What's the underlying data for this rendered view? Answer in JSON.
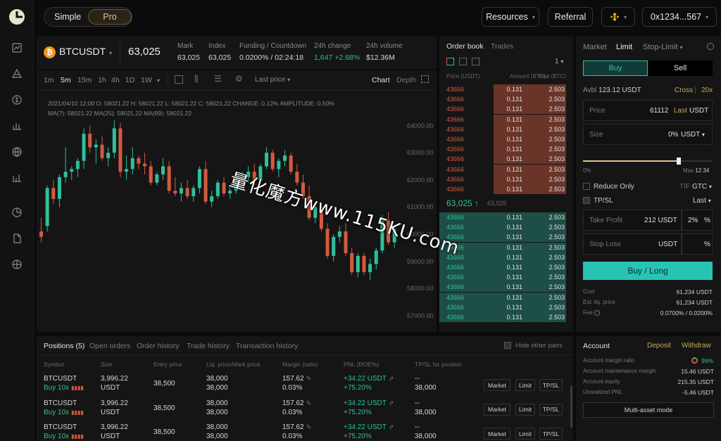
{
  "header": {
    "mode_simple": "Simple",
    "mode_pro": "Pro",
    "resources": "Resources",
    "referral": "Referral",
    "wallet": "0x1234...567"
  },
  "ticker": {
    "symbol": "BTCUSDT",
    "price": "63,025",
    "mark_label": "Mark",
    "mark_value": "63,025",
    "index_label": "Index",
    "index_value": "63,025",
    "funding_label": "Funding / Countdown",
    "funding_value": "0.0200% / 02:24:18",
    "change_label": "24h change",
    "change_value": "1,647 +2.68%",
    "volume_label": "24h volume",
    "volume_value": "$12.36M"
  },
  "chart": {
    "timeframes": [
      "1m",
      "5m",
      "15m",
      "1h",
      "4h",
      "1D",
      "1W"
    ],
    "active_timeframe": "5m",
    "price_type": "Last price",
    "view_chart": "Chart",
    "view_depth": "Depth",
    "ohlc_line": "2021/04/10 12:00  O: 58021.22  H: 58021.22  L: 58021.22  C: 58021.22  CHANGE: 0.12%  AMPLITUDE: 0.50%",
    "ma_line": "MA(7): 58021.22  MA(25): 58021.22  MA(99): 58021.22",
    "y_axis": [
      "64000.00",
      "63000.00",
      "62000.00",
      "61000.00",
      "60000.00",
      "59000.00",
      "58000.00",
      "57000.00"
    ],
    "colors": {
      "up": "#2fbf9b",
      "down": "#d25a3f"
    }
  },
  "chart_data": {
    "type": "candlestick",
    "ylim": [
      56500,
      65000
    ],
    "candles": [
      [
        60100,
        60600,
        59700,
        59900
      ],
      [
        60300,
        61800,
        60100,
        61700
      ],
      [
        61700,
        62000,
        61100,
        61300
      ],
      [
        61300,
        62200,
        61000,
        62100
      ],
      [
        62100,
        63200,
        61900,
        62300
      ],
      [
        62300,
        62500,
        62000,
        62400
      ],
      [
        62400,
        62800,
        62100,
        62700
      ],
      [
        62700,
        63900,
        62400,
        63700
      ],
      [
        63700,
        64000,
        63000,
        63200
      ],
      [
        63200,
        63500,
        62600,
        63300
      ],
      [
        63300,
        63600,
        62700,
        62800
      ],
      [
        62800,
        63200,
        62500,
        63000
      ],
      [
        63000,
        64200,
        62800,
        63900
      ],
      [
        63900,
        64100,
        62100,
        62300
      ],
      [
        62300,
        62900,
        62000,
        62400
      ],
      [
        62400,
        63200,
        62200,
        62800
      ],
      [
        62800,
        62900,
        62400,
        62600
      ],
      [
        62600,
        63000,
        62200,
        62500
      ],
      [
        62500,
        62700,
        61800,
        61900
      ],
      [
        61900,
        62300,
        61800,
        62200
      ],
      [
        62200,
        62800,
        62000,
        62500
      ],
      [
        62500,
        62700,
        61500,
        61600
      ],
      [
        61600,
        62100,
        61400,
        61500
      ],
      [
        61500,
        61900,
        61200,
        61700
      ],
      [
        61700,
        62000,
        61300,
        61400
      ],
      [
        61400,
        61800,
        61200,
        61700
      ],
      [
        61700,
        62500,
        61500,
        62400
      ],
      [
        62400,
        62700,
        61100,
        61200
      ],
      [
        61200,
        61600,
        61000,
        61400
      ],
      [
        61400,
        62000,
        61300,
        61900
      ],
      [
        61900,
        62100,
        61400,
        61500
      ],
      [
        61500,
        61800,
        61300,
        61600
      ],
      [
        61600,
        62100,
        61500,
        62000
      ],
      [
        62000,
        62300,
        61900,
        62100
      ],
      [
        62100,
        62500,
        61900,
        62300
      ],
      [
        62300,
        62600,
        61800,
        62000
      ],
      [
        62000,
        62600,
        61900,
        62500
      ],
      [
        62500,
        63200,
        62400,
        63000
      ],
      [
        63000,
        63100,
        62300,
        62400
      ],
      [
        62400,
        62800,
        62100,
        62700
      ],
      [
        62700,
        63100,
        62500,
        62900
      ],
      [
        62900,
        63000,
        62200,
        62300
      ],
      [
        62300,
        62600,
        61800,
        61900
      ],
      [
        61900,
        62200,
        61300,
        61400
      ],
      [
        61400,
        61800,
        60500,
        60600
      ],
      [
        60600,
        61100,
        60400,
        61000
      ],
      [
        61000,
        61100,
        60100,
        60200
      ],
      [
        60200,
        60400,
        59100,
        59200
      ],
      [
        59200,
        60000,
        59000,
        59900
      ],
      [
        59900,
        60300,
        59700,
        60100
      ],
      [
        60100,
        60400,
        59200,
        59300
      ],
      [
        59300,
        59500,
        58500,
        58600
      ],
      [
        58600,
        59300,
        58400,
        59200
      ],
      [
        59200,
        59300,
        58500,
        58600
      ],
      [
        58600,
        59100,
        58300,
        58900
      ],
      [
        58900,
        59500,
        58700,
        59400
      ],
      [
        59400,
        60700,
        59300,
        60500
      ],
      [
        60500,
        60800,
        59600,
        59700
      ],
      [
        59700,
        60300,
        59500,
        60200
      ]
    ]
  },
  "orderbook": {
    "tab_book": "Order book",
    "tab_trades": "Trades",
    "depth_select": "1",
    "col_price": "Price (USDT)",
    "col_amount": "Amount (BTC)",
    "col_total": "Total (BTC)",
    "asks": [
      [
        "43666",
        "0.131",
        "2.503"
      ],
      [
        "43666",
        "0.131",
        "2.503"
      ],
      [
        "43666",
        "0.131",
        "2.503"
      ],
      [
        "43666",
        "0.131",
        "2.503"
      ],
      [
        "43666",
        "0.131",
        "2.503"
      ],
      [
        "43666",
        "0.131",
        "2.503"
      ],
      [
        "43666",
        "0.131",
        "2.503"
      ],
      [
        "43666",
        "0.131",
        "2.503"
      ],
      [
        "43666",
        "0.131",
        "2.503"
      ],
      [
        "43666",
        "0.131",
        "2.503"
      ],
      [
        "43666",
        "0.131",
        "2.503"
      ]
    ],
    "mid_price": "63,025",
    "mid_arrow": "↑",
    "mid_mark": "63,025",
    "bids": [
      [
        "43666",
        "0.131",
        "2.503"
      ],
      [
        "43666",
        "0.131",
        "2.503"
      ],
      [
        "43666",
        "0.131",
        "2.503"
      ],
      [
        "43666",
        "0.131",
        "2.503"
      ],
      [
        "43666",
        "0.131",
        "2.503"
      ],
      [
        "43666",
        "0.131",
        "2.503"
      ],
      [
        "43666",
        "0.131",
        "2.503"
      ],
      [
        "43666",
        "0.131",
        "2.503"
      ],
      [
        "43666",
        "0.131",
        "2.503"
      ],
      [
        "43666",
        "0.131",
        "2.503"
      ],
      [
        "43666",
        "0.131",
        "2.503"
      ]
    ],
    "ask_depth": [
      0.57,
      0.57,
      0.57,
      0.57,
      0.57,
      0.57,
      0.57,
      0.57,
      0.57,
      0.57,
      0.57
    ],
    "bid_depth": [
      1,
      1,
      1,
      1,
      1,
      1,
      1,
      1,
      1,
      1,
      1
    ]
  },
  "trade": {
    "tab_market": "Market",
    "tab_limit": "Limit",
    "tab_stop": "Stop-Limit",
    "buy": "Buy",
    "sell": "Sell",
    "avbl_label": "Avbl",
    "avbl_value": "123.12 USDT",
    "margin_mode": "Cross",
    "leverage": "20x",
    "price_label": "Price",
    "price_value": "61112",
    "price_last": "Last",
    "price_unit": "USDT",
    "size_label": "Size",
    "size_value": "0%",
    "size_unit": "USDT",
    "slider_min": "0%",
    "slider_max_label": "Max",
    "slider_max": "12.34",
    "slider_fraction": 0.74,
    "reduce_only": "Reduce Only",
    "tif_label": "TIF",
    "tif_value": "GTC",
    "tpsl": "TP/SL",
    "tpsl_mode": "Last",
    "take_profit_label": "Take Profit",
    "take_profit_value": "212 USDT",
    "take_profit_pct": "2%",
    "pct_sign": "%",
    "stop_loss_label": "Stop Loss",
    "stop_loss_unit": "USDT",
    "submit": "Buy / Long",
    "cost_label": "Cost",
    "cost_value": "61,234 USDT",
    "liq_label": "Est. liq. price",
    "liq_value": "61,234 USDT",
    "fee_label": "Fee",
    "fee_value": "0.0700% / 0.0200%",
    "accent": "#27c4b4"
  },
  "positions": {
    "tabs": [
      "Positions (5)",
      "Open orders",
      "Order history",
      "Trade history",
      "Transaction history"
    ],
    "hide_other": "Hide other pairs",
    "columns": [
      "Symbol",
      "Size",
      "Entry price",
      "Liq. price/Mark price",
      "Margin (ratio)",
      "PNL (ROE%)",
      "TP/SL for position"
    ],
    "rows": [
      {
        "symbol": "BTCUSDT",
        "side": "Buy 10x",
        "size": "3,996.22",
        "size_unit": "USDT",
        "entry": "38,500",
        "liq": "38,000",
        "mark": "38,000",
        "margin": "157.62",
        "ratio": "0.03%",
        "pnl": "+34.22 USDT",
        "roe": "+75.20%",
        "tp": "--",
        "sl": "38,000"
      },
      {
        "symbol": "BTCUSDT",
        "side": "Buy 10x",
        "size": "3,996.22",
        "size_unit": "USDT",
        "entry": "38,500",
        "liq": "38,000",
        "mark": "38,000",
        "margin": "157.62",
        "ratio": "0.03%",
        "pnl": "+34.22 USDT",
        "roe": "+75.20%",
        "tp": "--",
        "sl": "38,000"
      },
      {
        "symbol": "BTCUSDT",
        "side": "Buy 10x",
        "size": "3,996.22",
        "size_unit": "USDT",
        "entry": "38,500",
        "liq": "38,000",
        "mark": "38,000",
        "margin": "157.62",
        "ratio": "0.03%",
        "pnl": "+34.22 USDT",
        "roe": "+75.20%",
        "tp": "--",
        "sl": "38,000"
      }
    ],
    "btn_market": "Market",
    "btn_limit": "Limit",
    "btn_tpsl": "TP/SL"
  },
  "account": {
    "title": "Account",
    "deposit": "Deposit",
    "withdraw": "Withdraw",
    "margin_ratio_label": "Account margin ratio",
    "margin_ratio_value": "99%",
    "maint_label": "Account maintenance margin",
    "maint_value": "15.46 USDT",
    "equity_label": "Account equity",
    "equity_value": "215.35 USDT",
    "upnl_label": "Unrealized PNL",
    "upnl_value": "-5.46 USDT",
    "multi_asset": "Multi-asset mode"
  },
  "watermark": "量化魔方www.115KU.com"
}
